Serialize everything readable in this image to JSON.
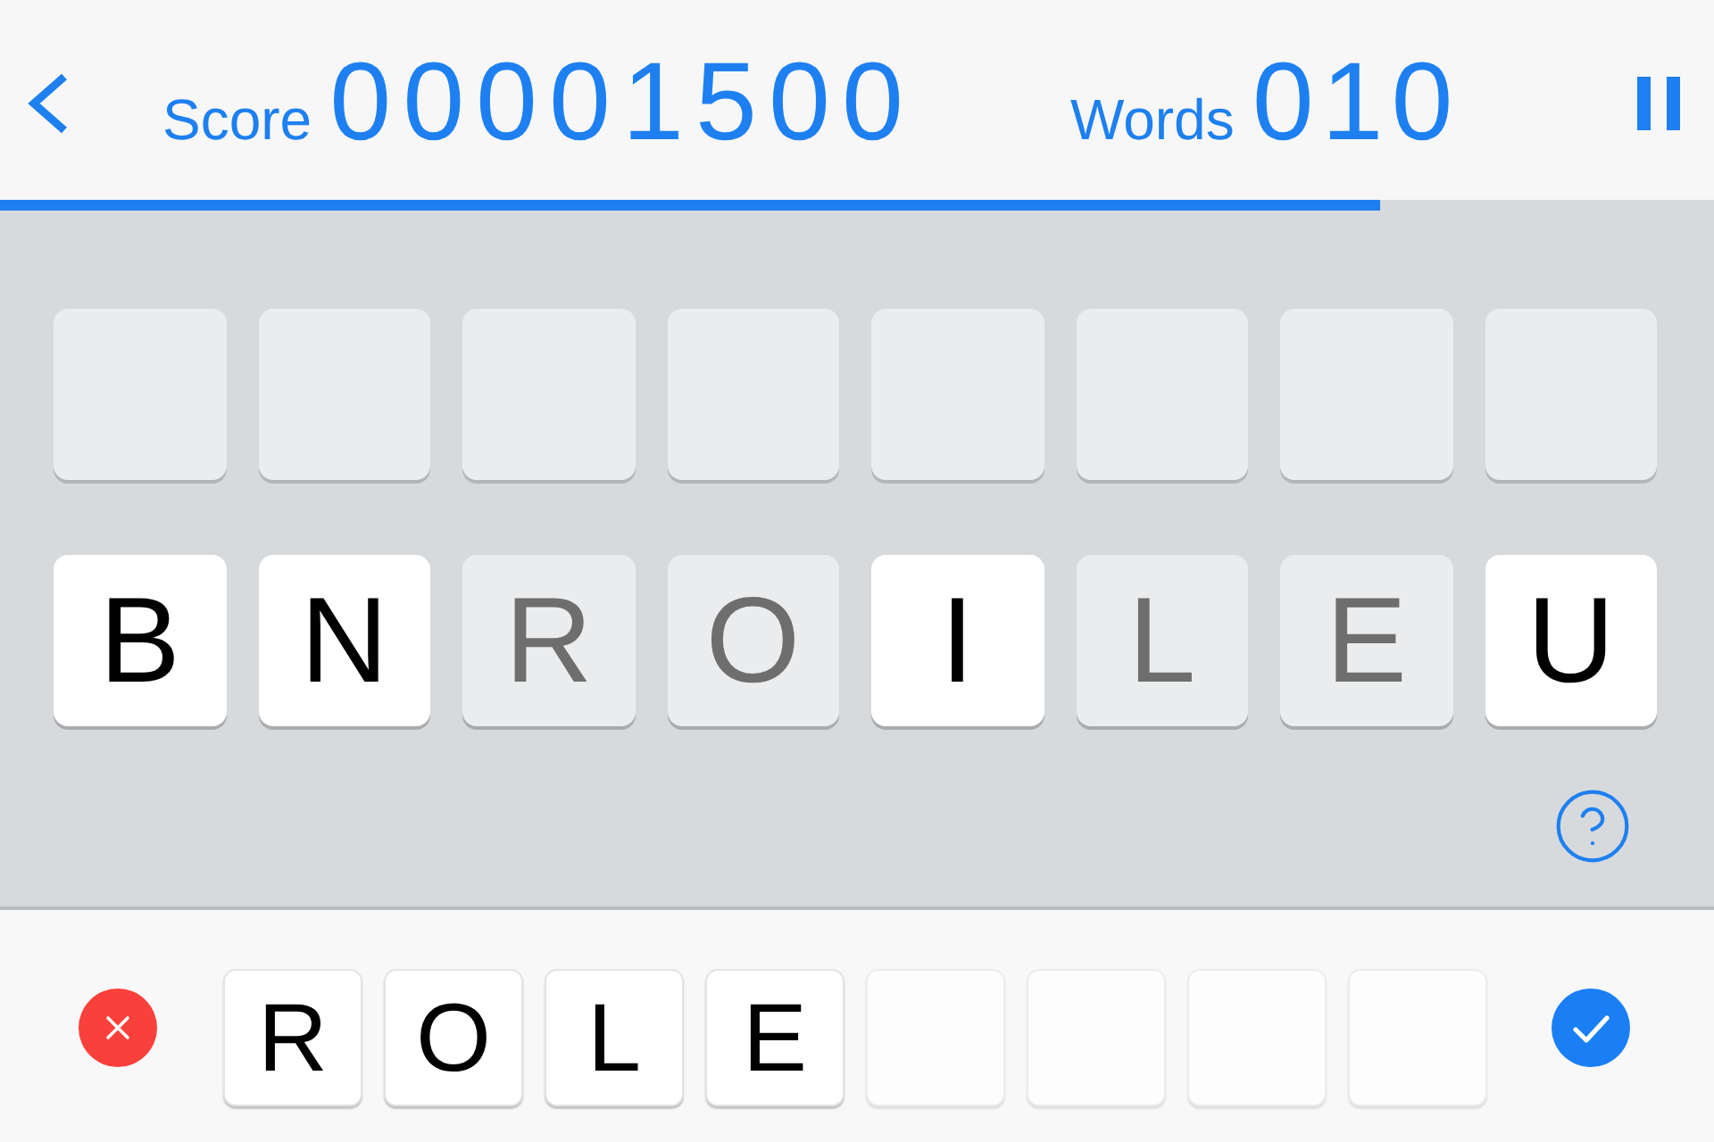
{
  "header": {
    "score_label": "Score",
    "score": "00001500",
    "words_label": "Words",
    "words": "010"
  },
  "progress": {
    "level": 0.805
  },
  "board": {
    "slots": [
      {
        "kind": "empty"
      },
      {
        "kind": "empty"
      },
      {
        "kind": "empty"
      },
      {
        "kind": "empty"
      },
      {
        "kind": "empty"
      },
      {
        "kind": "empty"
      },
      {
        "kind": "empty"
      },
      {
        "kind": "empty"
      }
    ],
    "letters": [
      {
        "letter": "B",
        "used": false
      },
      {
        "letter": "N",
        "used": false
      },
      {
        "letter": "R",
        "used": true
      },
      {
        "letter": "O",
        "used": true
      },
      {
        "letter": "I",
        "used": false
      },
      {
        "letter": "L",
        "used": true
      },
      {
        "letter": "E",
        "used": true
      },
      {
        "letter": "U",
        "used": false
      }
    ]
  },
  "answer": {
    "tiles": [
      {
        "kind": "letter",
        "letter": "R"
      },
      {
        "kind": "letter",
        "letter": "O"
      },
      {
        "kind": "letter",
        "letter": "L"
      },
      {
        "kind": "letter",
        "letter": "E"
      },
      {
        "kind": "empty"
      },
      {
        "kind": "empty"
      },
      {
        "kind": "empty"
      },
      {
        "kind": "empty"
      }
    ]
  }
}
